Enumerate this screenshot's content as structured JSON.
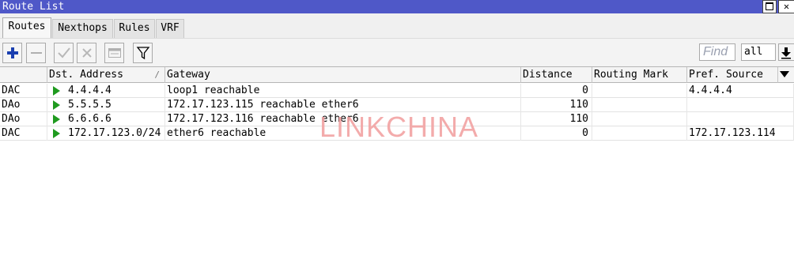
{
  "window": {
    "title": "Route List"
  },
  "tabs": [
    {
      "label": "Routes",
      "active": true
    },
    {
      "label": "Nexthops",
      "active": false
    },
    {
      "label": "Rules",
      "active": false
    },
    {
      "label": "VRF",
      "active": false
    }
  ],
  "toolbar": {
    "find_placeholder": "Find",
    "filter_value": "all",
    "buttons": [
      "add-icon",
      "remove-icon",
      "enable-icon",
      "disable-icon",
      "comment-icon",
      "filter-icon"
    ]
  },
  "table": {
    "columns": [
      "",
      "Dst. Address",
      "Gateway",
      "Distance",
      "Routing Mark",
      "Pref. Source"
    ],
    "rows": [
      {
        "flags": "DAC",
        "dst": "4.4.4.4",
        "gateway": "loop1 reachable",
        "distance": "0",
        "mark": "",
        "pref_source": "4.4.4.4"
      },
      {
        "flags": "DAo",
        "dst": "5.5.5.5",
        "gateway": "172.17.123.115 reachable ether6",
        "distance": "110",
        "mark": "",
        "pref_source": ""
      },
      {
        "flags": "DAo",
        "dst": "6.6.6.6",
        "gateway": "172.17.123.116 reachable ether6",
        "distance": "110",
        "mark": "",
        "pref_source": ""
      },
      {
        "flags": "DAC",
        "dst": "172.17.123.0/24",
        "gateway": "ether6 reachable",
        "distance": "0",
        "mark": "",
        "pref_source": "172.17.123.114"
      }
    ]
  },
  "watermark": "LINKCHINA",
  "colors": {
    "titlebar": "#4f58c8",
    "active_route": "#1f9a1f",
    "add_icon": "#1a3fb0",
    "watermark": "#f2a3a3"
  }
}
